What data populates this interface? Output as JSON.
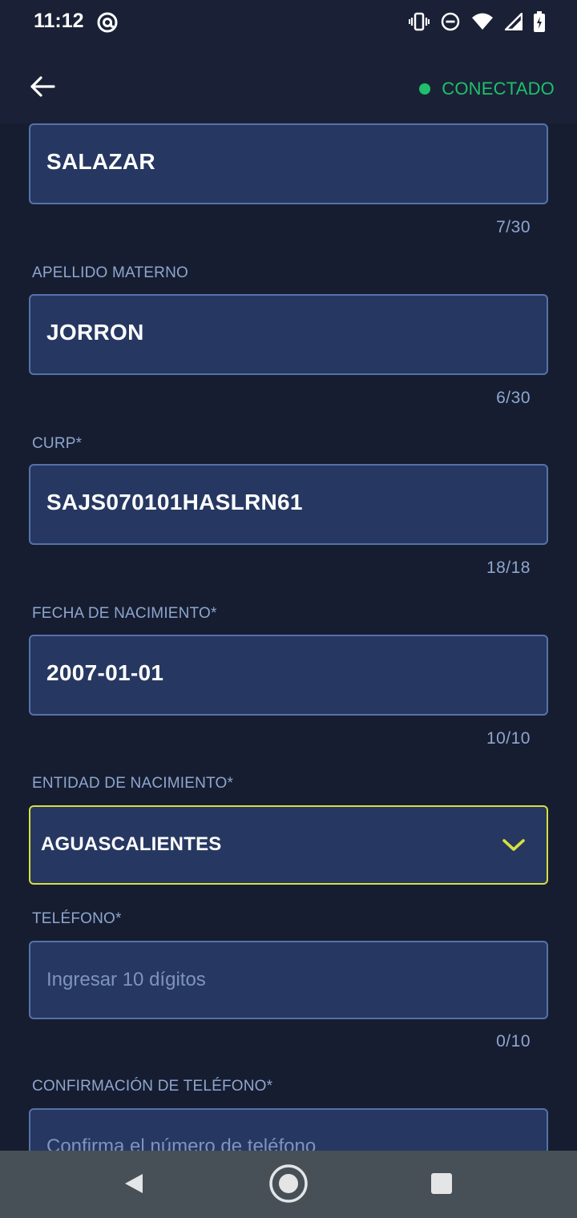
{
  "status_bar": {
    "time": "11:12",
    "icons": [
      "at-sign-icon",
      "vibrate-icon",
      "do-not-disturb-icon",
      "wifi-icon",
      "signal-icon",
      "battery-charging-icon"
    ]
  },
  "app_bar": {
    "back_icon": "arrow-left-icon",
    "connection_status": "CONECTADO",
    "connection_color": "#1fc06a"
  },
  "form": {
    "apellido_paterno": {
      "value": "SALAZAR",
      "counter": "7/30"
    },
    "apellido_materno": {
      "label": "APELLIDO MATERNO",
      "value": "JORRON",
      "counter": "6/30"
    },
    "curp": {
      "label": "CURP*",
      "value": "SAJS070101HASLRN61",
      "counter": "18/18"
    },
    "fecha_nacimiento": {
      "label": "FECHA DE NACIMIENTO*",
      "value": "2007-01-01",
      "counter": "10/10"
    },
    "entidad_nacimiento": {
      "label": "ENTIDAD DE NACIMIENTO*",
      "selected": "AGUASCALIENTES"
    },
    "telefono": {
      "label": "TELÉFONO*",
      "placeholder": "Ingresar 10 dígitos",
      "counter": "0/10"
    },
    "confirmacion_telefono": {
      "label": "CONFIRMACIÓN DE TELÉFONO*",
      "placeholder": "Confirma el número de teléfono"
    }
  },
  "colors": {
    "background": "#161d30",
    "field_fill": "#263862",
    "field_border": "#5572a8",
    "select_border_active": "#d8e03c",
    "label": "#8fa6cf"
  },
  "nav_bar": {
    "buttons": [
      "back-triangle-icon",
      "home-circle-icon",
      "recents-square-icon"
    ]
  }
}
